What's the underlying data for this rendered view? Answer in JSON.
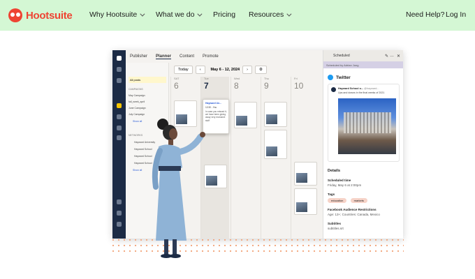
{
  "nav": {
    "brand": "Hootsuite",
    "items": [
      {
        "label": "Why Hootsuite",
        "has_menu": true
      },
      {
        "label": "What we do",
        "has_menu": true
      },
      {
        "label": "Pricing",
        "has_menu": false
      },
      {
        "label": "Resources",
        "has_menu": true
      }
    ],
    "help": "Need Help?",
    "login": "Log In",
    "bg_color": "#d4f7d4",
    "brand_color": "#ee4433"
  },
  "app": {
    "tabs": [
      "Publisher",
      "Planner",
      "Content",
      "Promote"
    ],
    "active_tab": "Planner",
    "toolbar": {
      "today": "Today",
      "range": "May 6 - 12, 2024"
    },
    "sidebar": {
      "all_posts": "All posts",
      "campaigns_header": "CAMPAIGNS",
      "campaigns": [
        "May Campaign",
        "fall_week_april",
        "June Campaign",
        "July Campaign"
      ],
      "show_all": "Show all",
      "networks_header": "NETWORKS",
      "networks": [
        "Hayward University",
        "Hayward School",
        "Hayward School",
        "Hayward School"
      ]
    },
    "days": [
      {
        "name": "SAT",
        "num": "6"
      },
      {
        "name": "Tue",
        "num": "7"
      },
      {
        "name": "Wed",
        "num": "8"
      },
      {
        "name": "Thu",
        "num": "9"
      },
      {
        "name": "Fri",
        "num": "10"
      }
    ],
    "post": {
      "account": "Hayward Un...",
      "time": "12:30 - You",
      "text": "In case you missed it, we have been giving away very exclusive stuff"
    },
    "panel": {
      "title": "Scheduled",
      "scheduled_by": "Scheduled by Adrian Jung",
      "network": "Twitter",
      "tweet_account": "Hayward School o...",
      "tweet_handle": "@hayward...",
      "tweet_text": "Ups and downs in the final weeks of 2021",
      "details_header": "Details",
      "scheduled_time_label": "Scheduled time",
      "scheduled_time": "Friday, May 6 at 2:00pm",
      "tags_label": "Tags",
      "tags": [
        "education",
        "markets"
      ],
      "restrictions_label": "Facebook Audience Restrictions",
      "restrictions": "Age: 13+; Countries: Canada, Mexico",
      "subtitles_label": "Subtitles",
      "subtitles": "subtitles.srt"
    }
  }
}
